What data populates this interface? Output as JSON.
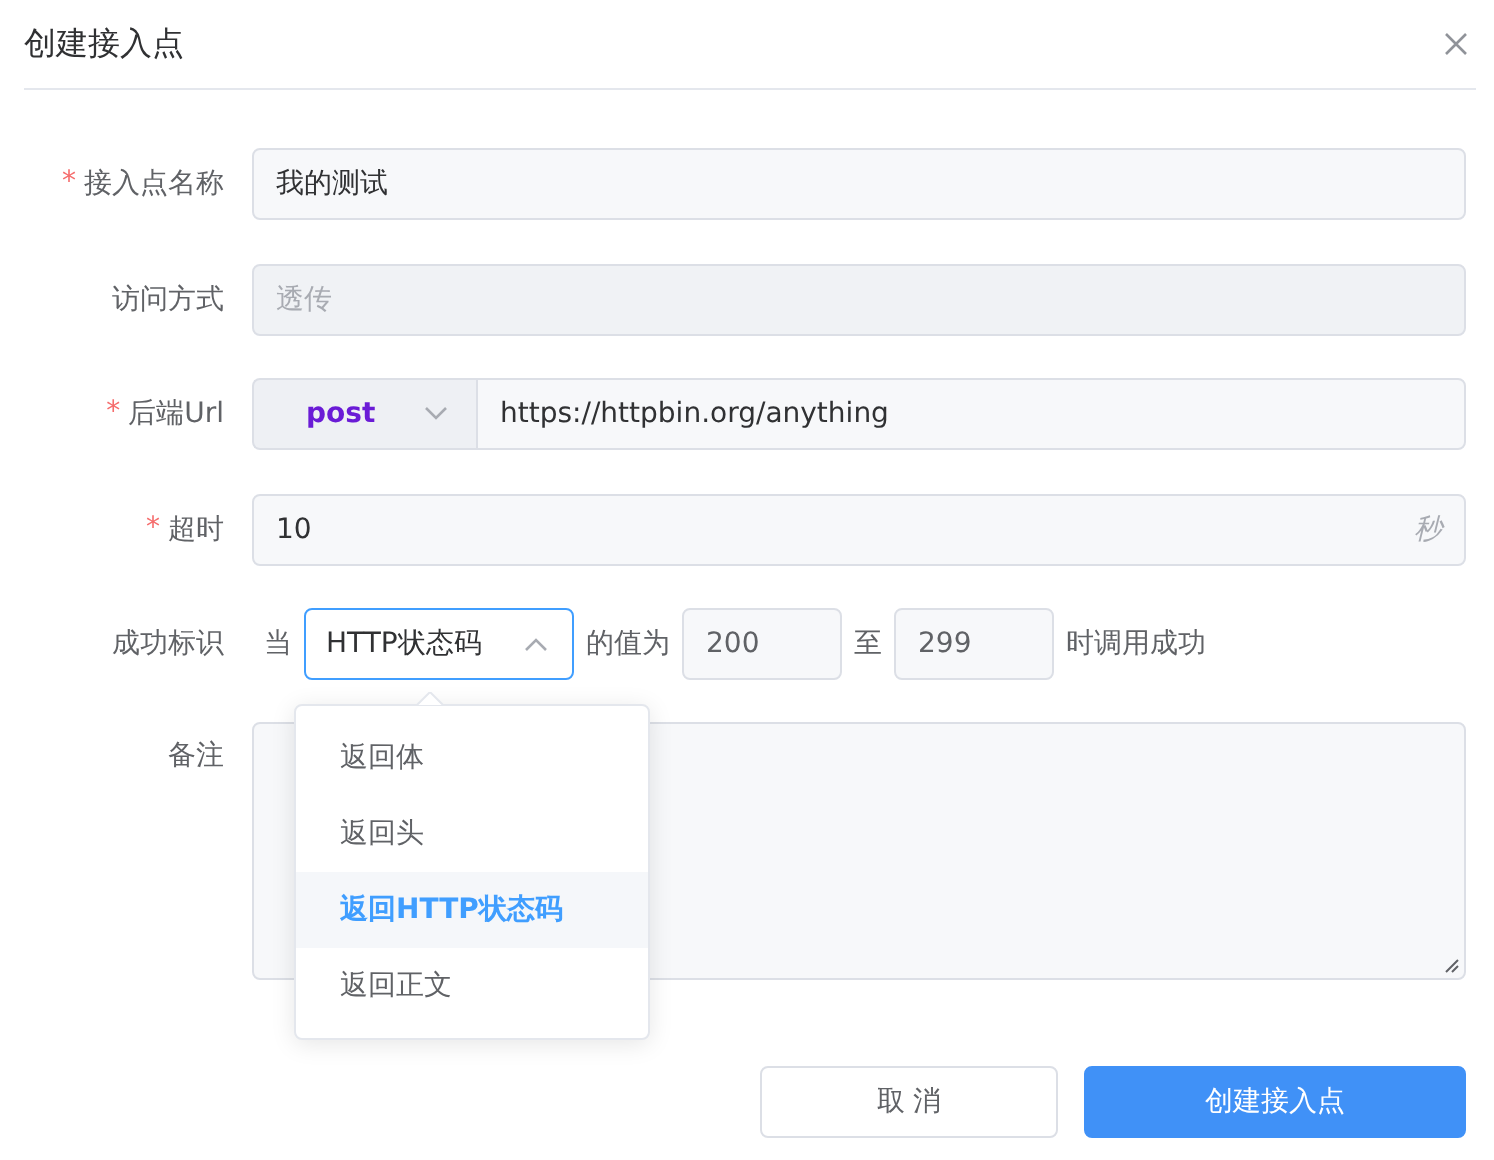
{
  "dialog": {
    "title": "创建接入点"
  },
  "fields": [
    {
      "kind": "text",
      "label": "接入点名称",
      "required": "*",
      "value": "我的测试",
      "disabled": false
    },
    {
      "kind": "text",
      "label": "访问方式",
      "value": "透传",
      "disabled": true
    },
    {
      "kind": "url",
      "label": "后端Url",
      "required": "*",
      "method": "post",
      "value": "https://httpbin.org/anything"
    },
    {
      "kind": "suffix",
      "label": "超时",
      "required": "*",
      "value": "10",
      "suffix": "秒"
    },
    {
      "kind": "success",
      "label": "成功标识",
      "prefix": "当",
      "select": "HTTP状态码",
      "expanded": true,
      "mid": "的值为",
      "from": "200",
      "sep": "至",
      "to": "299",
      "tail": "时调用成功"
    },
    {
      "kind": "textarea",
      "label": "备注"
    }
  ],
  "dropdown": [
    {
      "label": "返回体",
      "selected": false
    },
    {
      "label": "返回头",
      "selected": false
    },
    {
      "label": "返回HTTP状态码",
      "selected": true
    },
    {
      "label": "返回正文",
      "selected": false
    }
  ],
  "buttons": {
    "cancel": "取 消",
    "submit": "创建接入点"
  }
}
